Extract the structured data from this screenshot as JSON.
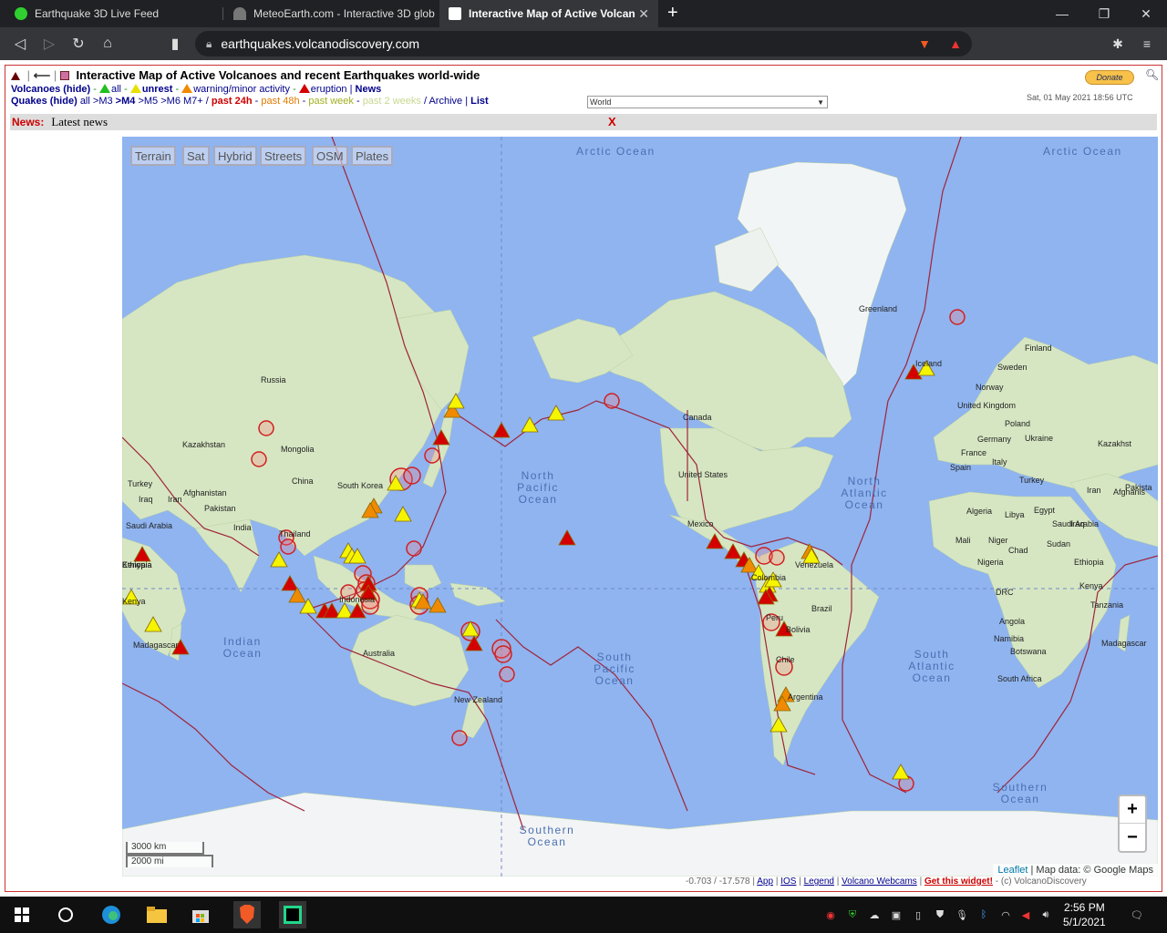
{
  "browser": {
    "tabs": [
      {
        "title": "Earthquake 3D Live Feed",
        "favicon": "green-dot-icon"
      },
      {
        "title": "MeteoEarth.com - Interactive 3D glob",
        "favicon": "meteo-icon"
      },
      {
        "title": "Interactive Map of Active Volcano",
        "favicon": "volcano-icon",
        "active": true
      }
    ],
    "new_tab": "+",
    "url": "earthquakes.volcanodiscovery.com",
    "window_controls": {
      "minimize": "—",
      "maximize": "❐",
      "close": "✕"
    }
  },
  "page": {
    "title": "Interactive Map of Active Volcanoes and recent Earthquakes world-wide",
    "volcanoes": {
      "label": "Volcanoes (hide)",
      "sep": "-",
      "all": "all",
      "unrest": "unrest",
      "warning": "warning/minor activity",
      "eruption": "eruption",
      "news": "News"
    },
    "quakes": {
      "label": "Quakes (hide)",
      "all": "all",
      "m3": ">M3",
      "m4": ">M4",
      "m5": ">M5",
      "m6": ">M6",
      "m7": "M7+",
      "sep": "/",
      "past24": "past 24h",
      "past48": "past 48h",
      "pastweek": "past week",
      "past2weeks": "past 2 weeks",
      "archive": "Archive",
      "list": "List"
    },
    "region": "World",
    "donate": "Donate",
    "datetime": "Sat, 01 May 2021 18:56 UTC",
    "news": {
      "label": "News:",
      "text": "Latest news",
      "close": "X"
    },
    "colors": {
      "eruption": "#d40000",
      "warning": "#f08a00",
      "unrest": "#f5f500",
      "all": "#22c022",
      "plate": "#a0243a",
      "ocean": "#8fb4f0",
      "land": "#cfe3b8"
    }
  },
  "map": {
    "type_buttons": [
      "Terrain",
      "Sat",
      "Hybrid",
      "Streets",
      "OSM",
      "Plates"
    ],
    "zoom_in": "+",
    "zoom_out": "−",
    "scale_km": "3000 km",
    "scale_mi": "2000 mi",
    "attribution_leaflet": "Leaflet",
    "attribution_rest": "| Map data: © Google Maps",
    "oceans": [
      "Arctic Ocean",
      "Arctic Ocean",
      "North Pacific Ocean",
      "North Atlantic Ocean",
      "Indian Ocean",
      "South Pacific Ocean",
      "South Atlantic Ocean",
      "Southern Ocean",
      "Southern Ocean"
    ],
    "lands": [
      "Greenland",
      "Russia",
      "Kazakhstan",
      "Mongolia",
      "China",
      "South Korea",
      "Afghanistan",
      "Pakistan",
      "India",
      "Thailand",
      "Iraq",
      "Iran",
      "Saudi Arabia",
      "Ethiopia",
      "Kenya",
      "Madagascar",
      "Indonesia",
      "Australia",
      "New Zealand",
      "Canada",
      "United States",
      "Mexico",
      "Venezuela",
      "Colombia",
      "Brazil",
      "Peru",
      "Bolivia",
      "Chile",
      "Argentina",
      "Iceland",
      "Finland",
      "Sweden",
      "Norway",
      "United Kingdom",
      "Poland",
      "Germany",
      "Ukraine",
      "France",
      "Spain",
      "Italy",
      "Turkey",
      "Kazakhst",
      "Algeria",
      "Libya",
      "Egypt",
      "Iraq",
      "Iran",
      "Afghanis",
      "Pakista",
      "Saudi Arabia",
      "Mali",
      "Niger",
      "Chad",
      "Sudan",
      "Nigeria",
      "Ethiopia",
      "DRC",
      "Kenya",
      "Tanzania",
      "Angola",
      "Namibia",
      "Botswana",
      "Madagascar",
      "South Africa",
      "Turkey",
      "Ethiopia",
      "Kenya"
    ]
  },
  "footer": {
    "coords": "-0.703 / -17.578",
    "app": "App",
    "ios": "IOS",
    "legend": "Legend",
    "webcams": "Volcano Webcams",
    "widget": "Get this widget!",
    "copyright": "- (c) VolcanoDiscovery"
  },
  "taskbar": {
    "time": "2:56 PM",
    "date": "5/1/2021"
  }
}
